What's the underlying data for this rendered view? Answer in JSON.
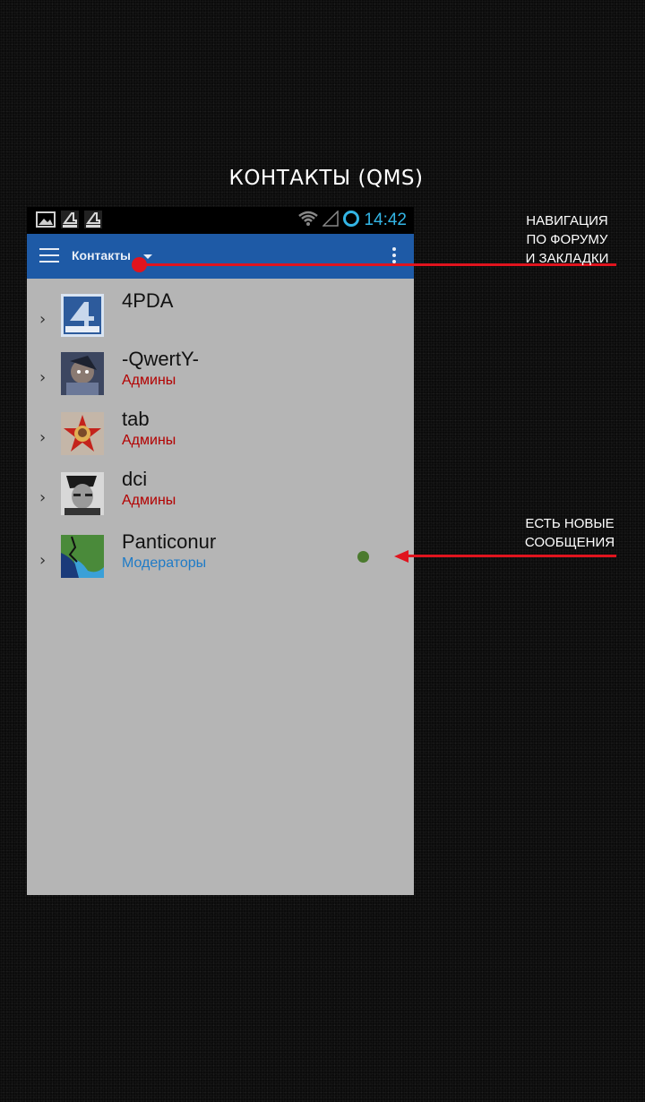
{
  "page_title": "КОНТАКТЫ (QMS)",
  "status_bar": {
    "time": "14:42"
  },
  "app_bar": {
    "title": "Контакты"
  },
  "contacts": [
    {
      "name": "4PDA",
      "group": ""
    },
    {
      "name": "-QwertY-",
      "group": "Админы"
    },
    {
      "name": "tab",
      "group": "Админы"
    },
    {
      "name": "dci",
      "group": "Админы"
    },
    {
      "name": "Panticonur",
      "group": "Модераторы",
      "has_new_messages": true
    }
  ],
  "annotations": {
    "navigation": [
      "НАВИГАЦИЯ",
      "ПО ФОРУМУ",
      "И ЗАКЛАДКИ"
    ],
    "new_messages": [
      "ЕСТЬ НОВЫЕ",
      "СООБЩЕНИЯ"
    ]
  },
  "colors": {
    "app_bar": "#1e5aa6",
    "content_bg": "#b5b5b5",
    "admin_group": "#b30000",
    "moderator_group": "#1e7bc7",
    "annotation_red": "#e0141e",
    "new_message_dot": "#4b7a2e",
    "clock": "#33b5e5"
  }
}
